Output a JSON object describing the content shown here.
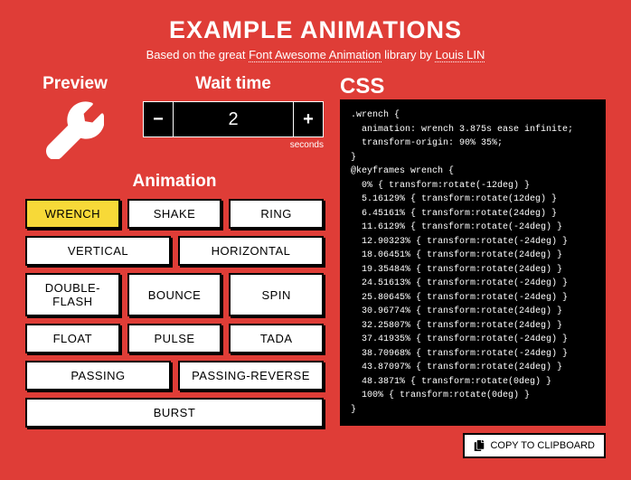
{
  "header": {
    "title": "Example animations",
    "subtitle_pre": "Based on the great ",
    "subtitle_link1": "Font Awesome Animation",
    "subtitle_mid": " library by ",
    "subtitle_link2": "Louis LIN"
  },
  "preview": {
    "heading": "Preview",
    "icon": "wrench"
  },
  "wait": {
    "heading": "Wait time",
    "value": "2",
    "units": "seconds",
    "minus": "−",
    "plus": "+"
  },
  "animation": {
    "heading": "Animation",
    "buttons": [
      {
        "label": "WRENCH",
        "active": true,
        "cls": "w3"
      },
      {
        "label": "SHAKE",
        "active": false,
        "cls": "w3"
      },
      {
        "label": "RING",
        "active": false,
        "cls": "w3"
      },
      {
        "label": "VERTICAL",
        "active": false,
        "cls": "w2"
      },
      {
        "label": "HORIZONTAL",
        "active": false,
        "cls": "w2"
      },
      {
        "label": "DOUBLE-FLASH",
        "active": false,
        "cls": "w3"
      },
      {
        "label": "BOUNCE",
        "active": false,
        "cls": "w3"
      },
      {
        "label": "SPIN",
        "active": false,
        "cls": "w3"
      },
      {
        "label": "FLOAT",
        "active": false,
        "cls": "w3"
      },
      {
        "label": "PULSE",
        "active": false,
        "cls": "w3"
      },
      {
        "label": "TADA",
        "active": false,
        "cls": "w3"
      },
      {
        "label": "PASSING",
        "active": false,
        "cls": "w2"
      },
      {
        "label": "PASSING-REVERSE",
        "active": false,
        "cls": "w2"
      },
      {
        "label": "BURST",
        "active": false,
        "cls": "full"
      }
    ]
  },
  "css": {
    "heading": "CSS",
    "code": ".wrench {\n  animation: wrench 3.875s ease infinite;\n  transform-origin: 90% 35%;\n}\n@keyframes wrench {\n  0% { transform:rotate(-12deg) }\n  5.16129% { transform:rotate(12deg) }\n  6.45161% { transform:rotate(24deg) }\n  11.6129% { transform:rotate(-24deg) }\n  12.90323% { transform:rotate(-24deg) }\n  18.06451% { transform:rotate(24deg) }\n  19.35484% { transform:rotate(24deg) }\n  24.51613% { transform:rotate(-24deg) }\n  25.80645% { transform:rotate(-24deg) }\n  30.96774% { transform:rotate(24deg) }\n  32.25807% { transform:rotate(24deg) }\n  37.41935% { transform:rotate(-24deg) }\n  38.70968% { transform:rotate(-24deg) }\n  43.87097% { transform:rotate(24deg) }\n  48.3871% { transform:rotate(0deg) }\n  100% { transform:rotate(0deg) }\n}",
    "copy_label": "COPY TO CLIPBOARD"
  }
}
